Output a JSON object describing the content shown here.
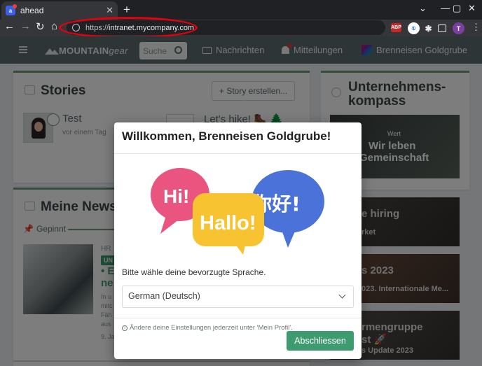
{
  "browser": {
    "tab_title": "ahead",
    "tab_favicon": "ahead-icon",
    "url_scheme": "https://",
    "url_host": "intranet.mycompany.com",
    "extension_badge": "ABP",
    "profile_initial": "T",
    "window_controls": [
      "—",
      "▢",
      "✕"
    ]
  },
  "app": {
    "logo_main": "MOUNTAIN",
    "logo_accent": "gear",
    "search_placeholder": "Suche",
    "nav": {
      "messages": "Nachrichten",
      "notifications": "Mitteilungen",
      "user": "Brenneisen Goldgrube"
    }
  },
  "stories": {
    "title": "Stories",
    "create_button": "+ Story erstellen...",
    "items": [
      {
        "name": "Test",
        "time": "vor einem Tag"
      },
      {
        "name": "Let's hike! 🥾 🌲"
      }
    ]
  },
  "news": {
    "title": "Meine News",
    "pinned_label": "Gepinnt",
    "category": "HR",
    "badge": "UN",
    "headline_part1": "• E",
    "headline_part2": "ne",
    "text_lines": [
      "In u",
      "mitc",
      "Fäh",
      "aus"
    ],
    "date": "9. Ja"
  },
  "right": {
    "title_line1": "Unternehmens-",
    "title_line2": "kompass",
    "values_label": "Wert",
    "values_line1": "Wir leben",
    "values_line2": "Gemeinschaft",
    "card2_title": "e hiring",
    "card2_sub": "rket",
    "card3_title": "s 2023",
    "card3_sub": "023. Internationale Me...",
    "card4_title": "rmengruppe",
    "card4_title2": "st 🚀",
    "card4_sub": "s Update 2023"
  },
  "modal": {
    "title": "Willkommen, Brenneisen Goldgrube!",
    "bubble1": "Hi!",
    "bubble2": "Hallo!",
    "bubble3": "你好!",
    "language_prompt": "Bitte wähle deine bevorzugte Sprache.",
    "selected_language": "German (Deutsch)",
    "info_text": "Ändere deine Einstellungen jederzeit unter 'Mein Profil'.",
    "finish_button": "Abschliessen"
  },
  "colors": {
    "brand_green": "#3d9b6f",
    "header": "#5b6b6f",
    "annotation_red": "#e3000f",
    "bubble_pink": "#e9557f",
    "bubble_yellow": "#f7c330",
    "bubble_blue": "#4a72d8"
  }
}
